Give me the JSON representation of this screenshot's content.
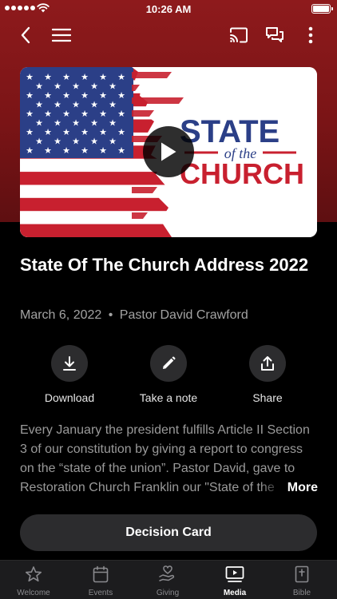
{
  "status_bar": {
    "time": "10:26 AM"
  },
  "nav": {
    "back": "chevron-left-icon",
    "menu": "hamburger-menu-icon",
    "cast": "cast-icon",
    "chat": "chat-bubbles-icon",
    "more": "more-vertical-icon"
  },
  "thumbnail": {
    "logo_line1": "STATE",
    "logo_line2": "of the",
    "logo_line3": "CHURCH",
    "colors": {
      "red": "#c8202f",
      "navy": "#2b3f87",
      "white": "#ffffff"
    }
  },
  "sermon": {
    "title": "State Of The Church Address 2022",
    "date": "March 6, 2022",
    "separator": "•",
    "speaker": "Pastor David Crawford",
    "description": "Every January the president fulfills Article II Section 3 of our constitution by giving a report to congress on the “state of the union”. Pastor David, gave to Restoration Church Franklin our \"State of the Church\"",
    "more_label": "More"
  },
  "actions": [
    {
      "label": "Download",
      "icon": "download-icon"
    },
    {
      "label": "Take a note",
      "icon": "pencil-icon"
    },
    {
      "label": "Share",
      "icon": "share-icon"
    }
  ],
  "decision_card": {
    "label": "Decision  Card"
  },
  "tabs": [
    {
      "label": "Welcome",
      "icon": "star-icon",
      "active": false
    },
    {
      "label": "Events",
      "icon": "calendar-icon",
      "active": false
    },
    {
      "label": "Giving",
      "icon": "giving-hand-icon",
      "active": false
    },
    {
      "label": "Media",
      "icon": "media-player-icon",
      "active": true
    },
    {
      "label": "Bible",
      "icon": "bible-icon",
      "active": false
    }
  ],
  "theme": {
    "header_red": "#8e1a1c",
    "background": "#000000",
    "button_gray": "#2c2c2e",
    "text_muted": "#a3a3a3"
  }
}
